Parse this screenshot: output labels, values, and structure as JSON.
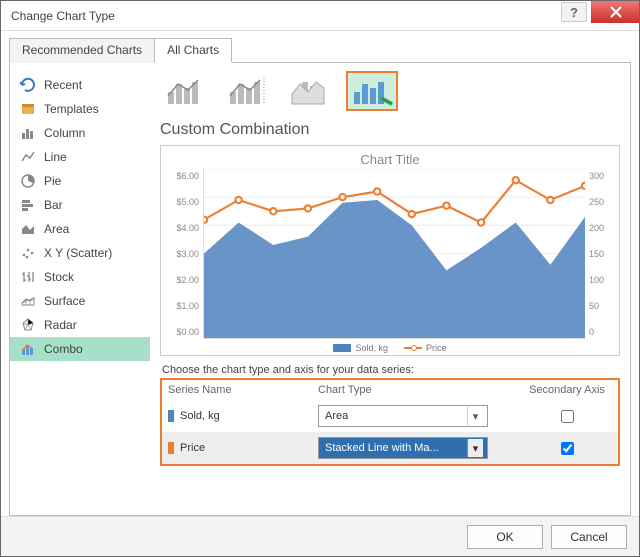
{
  "window": {
    "title": "Change Chart Type"
  },
  "tabs": {
    "recommended": "Recommended Charts",
    "all": "All Charts"
  },
  "sidebar": {
    "items": [
      {
        "label": "Recent"
      },
      {
        "label": "Templates"
      },
      {
        "label": "Column"
      },
      {
        "label": "Line"
      },
      {
        "label": "Pie"
      },
      {
        "label": "Bar"
      },
      {
        "label": "Area"
      },
      {
        "label": "X Y (Scatter)"
      },
      {
        "label": "Stock"
      },
      {
        "label": "Surface"
      },
      {
        "label": "Radar"
      },
      {
        "label": "Combo"
      }
    ]
  },
  "main": {
    "section_title": "Custom Combination",
    "preview_title": "Chart Title",
    "legend": {
      "s1": "Sold, kg",
      "s2": "Price"
    },
    "series_caption": "Choose the chart type and axis for your data series:",
    "headers": {
      "name": "Series Name",
      "type": "Chart Type",
      "axis": "Secondary Axis"
    },
    "rows": [
      {
        "swatch": "#4f81bd",
        "name": "Sold, kg",
        "type": "Area",
        "secondary": false
      },
      {
        "swatch": "#ed7d31",
        "name": "Price",
        "type": "Stacked Line with Ma...",
        "secondary": true
      }
    ]
  },
  "footer": {
    "ok": "OK",
    "cancel": "Cancel"
  },
  "chart_data": {
    "type": "combo",
    "title": "Chart Title",
    "y_left": {
      "label": "",
      "ticks": [
        "$6.00",
        "$5.00",
        "$4.00",
        "$3.00",
        "$2.00",
        "$1.00",
        "$0.00"
      ],
      "range": [
        0,
        6
      ]
    },
    "y_right": {
      "label": "",
      "ticks": [
        "300",
        "250",
        "200",
        "150",
        "100",
        "50",
        "0"
      ],
      "range": [
        0,
        300
      ]
    },
    "x_count": 12,
    "series": [
      {
        "name": "Sold, kg",
        "type": "area",
        "axis": "left",
        "color": "#4f81bd",
        "values": [
          3.0,
          4.1,
          3.3,
          3.6,
          4.8,
          4.9,
          4.0,
          2.4,
          3.2,
          4.1,
          2.6,
          4.3
        ]
      },
      {
        "name": "Price",
        "type": "line_marker",
        "axis": "right",
        "color": "#ed7d31",
        "values": [
          210,
          245,
          225,
          230,
          250,
          260,
          220,
          235,
          205,
          280,
          245,
          270
        ]
      }
    ]
  }
}
